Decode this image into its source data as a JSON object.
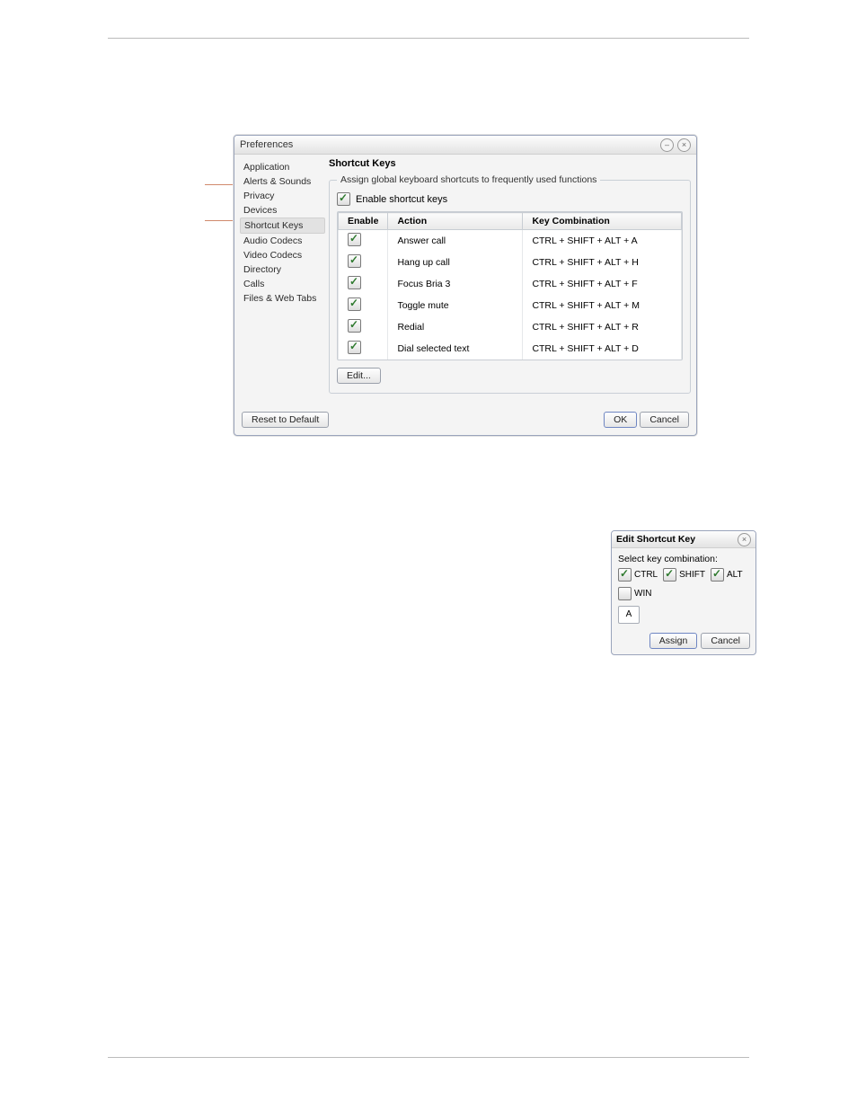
{
  "prefs": {
    "title": "Preferences",
    "sidebar": [
      {
        "label": "Application"
      },
      {
        "label": "Alerts & Sounds"
      },
      {
        "label": "Privacy"
      },
      {
        "label": "Devices"
      },
      {
        "label": "Shortcut Keys",
        "selected": true
      },
      {
        "label": "Audio Codecs"
      },
      {
        "label": "Video Codecs"
      },
      {
        "label": "Directory"
      },
      {
        "label": "Calls"
      },
      {
        "label": "Files & Web Tabs"
      }
    ],
    "panel": {
      "title": "Shortcut Keys",
      "group_legend": "Assign global keyboard shortcuts to frequently used functions",
      "enable_label": "Enable shortcut keys",
      "columns": {
        "enable": "Enable",
        "action": "Action",
        "combo": "Key Combination"
      },
      "rows": [
        {
          "action": "Answer call",
          "combo": "CTRL + SHIFT + ALT + A"
        },
        {
          "action": "Hang up call",
          "combo": "CTRL + SHIFT + ALT + H"
        },
        {
          "action": "Focus Bria 3",
          "combo": "CTRL + SHIFT + ALT + F"
        },
        {
          "action": "Toggle mute",
          "combo": "CTRL + SHIFT + ALT + M"
        },
        {
          "action": "Redial",
          "combo": "CTRL + SHIFT + ALT + R"
        },
        {
          "action": "Dial selected text",
          "combo": "CTRL + SHIFT + ALT + D"
        }
      ],
      "edit_btn": "Edit..."
    },
    "footer": {
      "reset": "Reset to Default",
      "ok": "OK",
      "cancel": "Cancel"
    }
  },
  "edit": {
    "title": "Edit Shortcut Key",
    "select_label": "Select key combination:",
    "mods": [
      {
        "label": "CTRL",
        "checked": true
      },
      {
        "label": "SHIFT",
        "checked": true
      },
      {
        "label": "ALT",
        "checked": true
      },
      {
        "label": "WIN",
        "checked": false
      }
    ],
    "key": "A",
    "assign": "Assign",
    "cancel": "Cancel"
  }
}
